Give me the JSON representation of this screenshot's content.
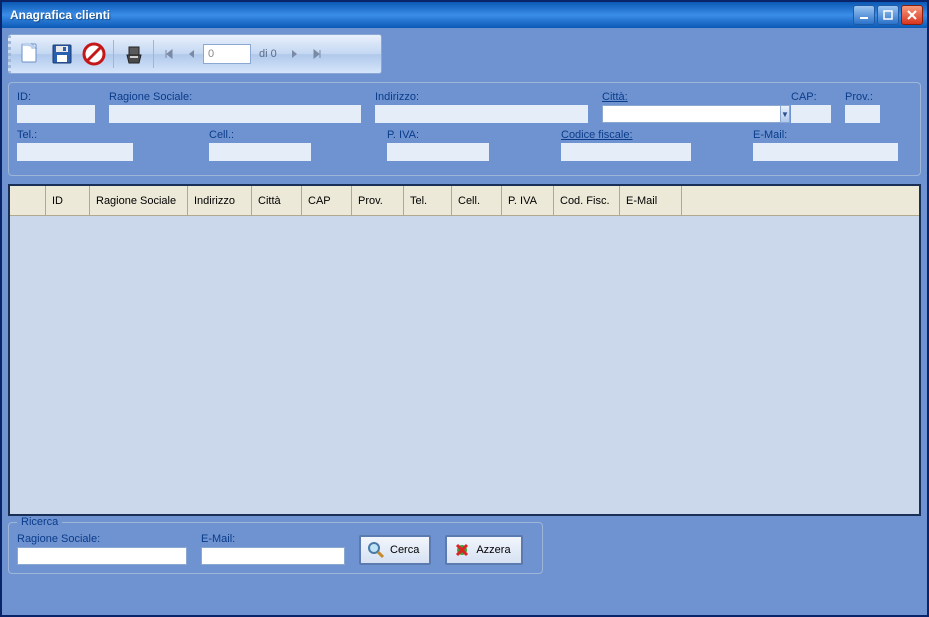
{
  "window": {
    "title": "Anagrafica clienti"
  },
  "toolbar": {
    "nav_value": "0",
    "nav_total": "di 0"
  },
  "form": {
    "id_label": "ID:",
    "id": "",
    "ragione_label": "Ragione Sociale:",
    "ragione": "",
    "indirizzo_label": "Indirizzo:",
    "indirizzo": "",
    "citta_label": "Città:",
    "citta": "",
    "cap_label": "CAP:",
    "cap": "",
    "prov_label": "Prov.:",
    "prov": "",
    "tel_label": "Tel.:",
    "tel": "",
    "cell_label": "Cell.:",
    "cell": "",
    "piva_label": "P. IVA:",
    "piva": "",
    "codfisc_label": "Codice fiscale:",
    "codfisc": "",
    "email_label": "E-Mail:",
    "email": ""
  },
  "grid": {
    "columns": [
      "",
      "ID",
      "Ragione Sociale",
      "Indirizzo",
      "Città",
      "CAP",
      "Prov.",
      "Tel.",
      "Cell.",
      "P. IVA",
      "Cod. Fisc.",
      "E-Mail"
    ]
  },
  "search": {
    "title": "Ricerca",
    "ragione_label": "Ragione Sociale:",
    "ragione": "",
    "email_label": "E-Mail:",
    "email": "",
    "cerca_label": "Cerca",
    "azzera_label": "Azzera"
  }
}
